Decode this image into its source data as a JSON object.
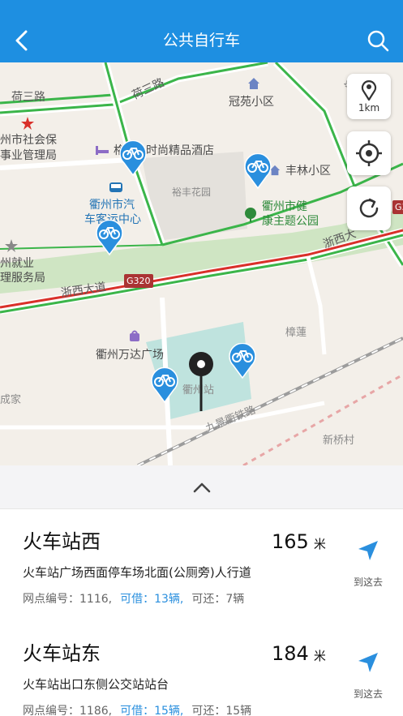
{
  "header": {
    "title": "公共自行车"
  },
  "map": {
    "scale_label": "1km",
    "labels": {
      "he_san_road_left": "荷三路",
      "he_san_road_top": "荷三路",
      "guanyuan": "冠苑小区",
      "social_security_1": "州市社会保",
      "social_security_2": "事业管理局",
      "hotel_prefix": "格",
      "hotel": "时尚精品酒店",
      "yufeng_garden": "裕丰花园",
      "fenglin": "丰林小区",
      "bus_station_1": "衢州市汽",
      "bus_station_2": "车客运中心",
      "health_park_1": "衢州市健",
      "health_park_2": "康主题公园",
      "employment_1": "州就业",
      "employment_2": "理服务局",
      "zhexi_road_left": "浙西大道",
      "zhexi_road_right": "浙西大",
      "g320": "G320",
      "g320_right": "G3",
      "wanda": "衢州万达广场",
      "quzhou_station": "衢州站",
      "zhangjian": "樟蓮",
      "chengjia": "成家",
      "jiujing_railway": "九景衢铁路",
      "xinqiao": "新桥村",
      "railway_road": "铁路"
    }
  },
  "stations": [
    {
      "name": "火车站西",
      "distance": "165",
      "unit": "米",
      "address": "火车站广场西面停车场北面(公厕旁)人行道",
      "code_text": "网点编号：1116,",
      "available_text": "可借：13辆,",
      "return_text": "可还：7辆",
      "go_label": "到这去"
    },
    {
      "name": "火车站东",
      "distance": "184",
      "unit": "米",
      "address": "火车站出口东侧公交站站台",
      "code_text": "网点编号：1186,",
      "available_text": "可借：15辆,",
      "return_text": "可还：15辆",
      "go_label": "到这去"
    }
  ],
  "colors": {
    "header": "#1e8fe1",
    "accent_blue": "#2a8fde",
    "park_green": "#cfe5c3",
    "road_green": "#3bb54a",
    "road_red": "#d9302a"
  },
  "icons": [
    "back-arrow-icon",
    "search-icon",
    "map-pin-icon",
    "locate-crosshair-icon",
    "refresh-icon",
    "bicycle-pin-icon",
    "chevron-up-icon",
    "navigate-arrow-icon"
  ]
}
